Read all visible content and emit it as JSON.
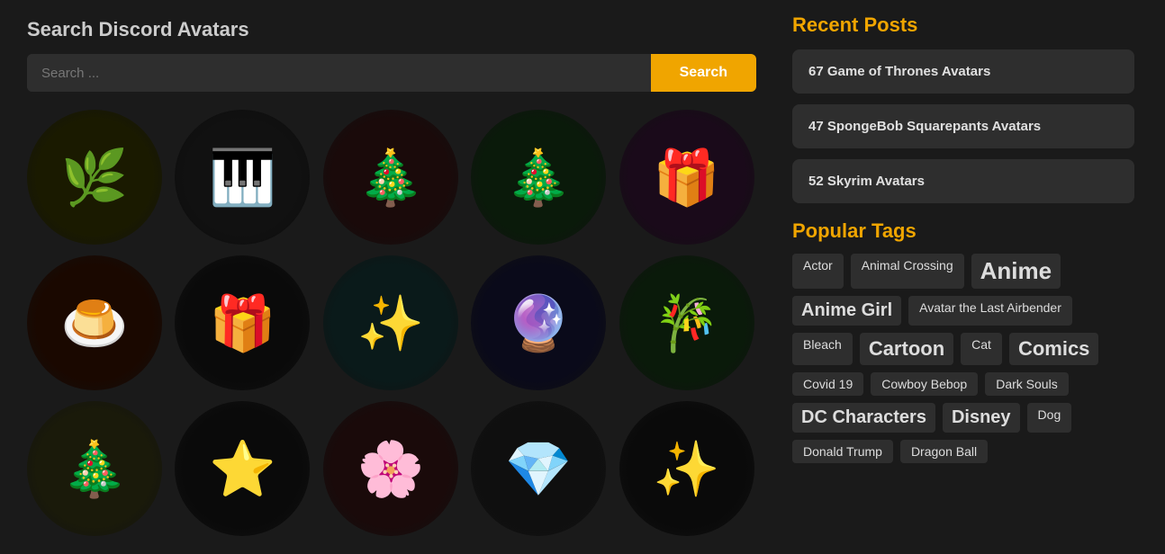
{
  "search": {
    "title": "Search Discord Avatars",
    "placeholder": "Search ...",
    "button_label": "Search"
  },
  "recent_posts": {
    "title": "Recent Posts",
    "items": [
      {
        "label": "67 Game of Thrones Avatars"
      },
      {
        "label": "47 SpongeBob Squarepants Avatars"
      },
      {
        "label": "52 Skyrim Avatars"
      }
    ]
  },
  "popular_tags": {
    "title": "Popular Tags",
    "tags": [
      {
        "label": "Actor",
        "size": "small"
      },
      {
        "label": "Animal Crossing",
        "size": "small"
      },
      {
        "label": "Anime",
        "size": "large"
      },
      {
        "label": "Anime Girl",
        "size": "medium"
      },
      {
        "label": "Avatar the Last Airbender",
        "size": "small"
      },
      {
        "label": "Bleach",
        "size": "small"
      },
      {
        "label": "Cartoon",
        "size": "medium2"
      },
      {
        "label": "Cat",
        "size": "small"
      },
      {
        "label": "Comics",
        "size": "medium2"
      },
      {
        "label": "Covid 19",
        "size": "small"
      },
      {
        "label": "Cowboy Bebop",
        "size": "small"
      },
      {
        "label": "Dark Souls",
        "size": "small"
      },
      {
        "label": "DC Characters",
        "size": "medium"
      },
      {
        "label": "Disney",
        "size": "medium"
      },
      {
        "label": "Dog",
        "size": "small"
      },
      {
        "label": "Donald Trump",
        "size": "small"
      },
      {
        "label": "Dragon Ball",
        "size": "small"
      }
    ]
  },
  "avatars": [
    {
      "emoji": "🌿",
      "class": "av1"
    },
    {
      "emoji": "🎹",
      "class": "av2"
    },
    {
      "emoji": "🎄",
      "class": "av3"
    },
    {
      "emoji": "🎄",
      "class": "av4"
    },
    {
      "emoji": "🎁",
      "class": "av5"
    },
    {
      "emoji": "🍮",
      "class": "av6"
    },
    {
      "emoji": "🎁",
      "class": "av7"
    },
    {
      "emoji": "✨",
      "class": "av8"
    },
    {
      "emoji": "🔮",
      "class": "av9"
    },
    {
      "emoji": "🎋",
      "class": "av10"
    },
    {
      "emoji": "🎄",
      "class": "av11"
    },
    {
      "emoji": "⭐",
      "class": "av12"
    },
    {
      "emoji": "🌸",
      "class": "av13"
    },
    {
      "emoji": "💎",
      "class": "av14"
    },
    {
      "emoji": "✨",
      "class": "av15"
    }
  ]
}
